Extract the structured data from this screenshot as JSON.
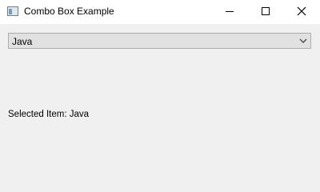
{
  "window": {
    "title": "Combo Box Example",
    "icon": "window-app-icon"
  },
  "controls": {
    "minimize_icon": "minimize-icon",
    "maximize_icon": "maximize-icon",
    "close_icon": "close-icon"
  },
  "combo": {
    "selected": "Java",
    "arrow_icon": "chevron-down-icon"
  },
  "status": {
    "text": "Selected Item: Java"
  }
}
